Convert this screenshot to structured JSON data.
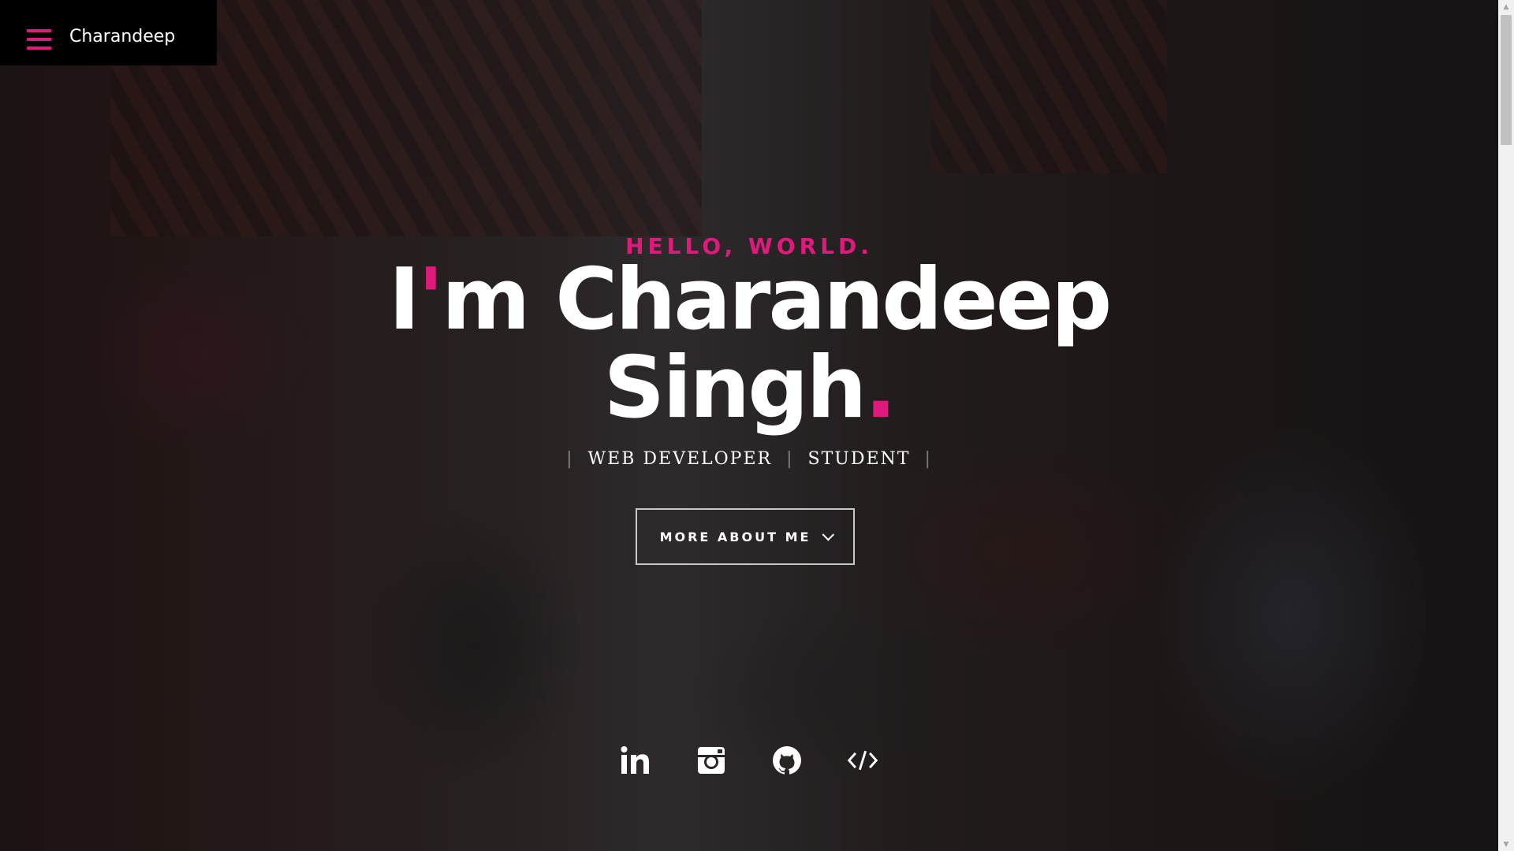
{
  "header": {
    "brand": "Charandeep",
    "menu_icon": "hamburger-menu-icon",
    "accent_color": "#e0197d"
  },
  "hero": {
    "greeting": "HELLO, WORLD.",
    "headline_first": "I",
    "headline_apostrophe": "'",
    "headline_rest_line1": "m Charandeep",
    "headline_line2": "Singh",
    "headline_period": ".",
    "roles": [
      "WEB DEVELOPER",
      "STUDENT"
    ],
    "separator": "|",
    "cta_label": "MORE ABOUT ME",
    "cta_icon": "chevron-down-icon"
  },
  "social": [
    {
      "name": "linkedin-icon"
    },
    {
      "name": "instagram-icon"
    },
    {
      "name": "github-icon"
    },
    {
      "name": "code-icon"
    }
  ],
  "scrollbar": {
    "up_arrow": "▲",
    "down_arrow": "▼"
  }
}
